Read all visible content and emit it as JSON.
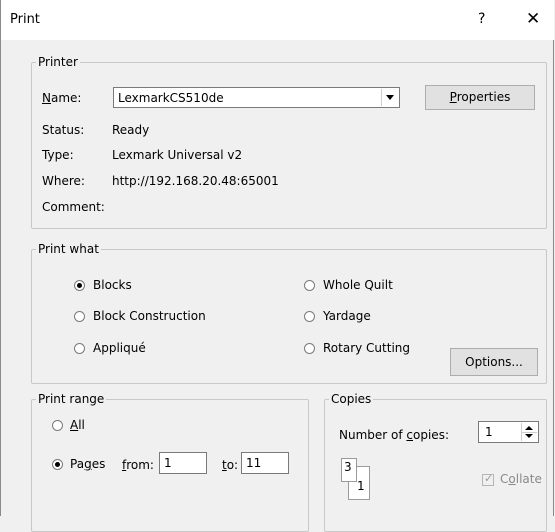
{
  "window": {
    "title": "Print",
    "help_glyph": "?",
    "close_glyph": "✕"
  },
  "printer": {
    "legend": "Printer",
    "name_label": "Name:",
    "name_value": "LexmarkCS510de",
    "properties_label": "Properties",
    "status_label": "Status:",
    "status_value": "Ready",
    "type_label": "Type:",
    "type_value": "Lexmark Universal v2",
    "where_label": "Where:",
    "where_value": "http://192.168.20.48:65001",
    "comment_label": "Comment:",
    "comment_value": ""
  },
  "print_what": {
    "legend": "Print what",
    "options": [
      {
        "label": "Blocks",
        "checked": true
      },
      {
        "label": "Block Construction",
        "checked": false
      },
      {
        "label": "Appliqué",
        "checked": false
      },
      {
        "label": "Whole Quilt",
        "checked": false
      },
      {
        "label": "Yardage",
        "checked": false
      },
      {
        "label": "Rotary Cutting",
        "checked": false
      }
    ],
    "options_button": "Options..."
  },
  "print_range": {
    "legend": "Print range",
    "all_label": "All",
    "pages_label": "Pages",
    "from_label": "from:",
    "from_value": "1",
    "to_label": "to:",
    "to_value": "11"
  },
  "copies": {
    "legend": "Copies",
    "number_label": "Number of copies:",
    "number_value": "1",
    "icon_front_page": "3",
    "icon_back_page": "1",
    "collate_label": "Collate"
  }
}
